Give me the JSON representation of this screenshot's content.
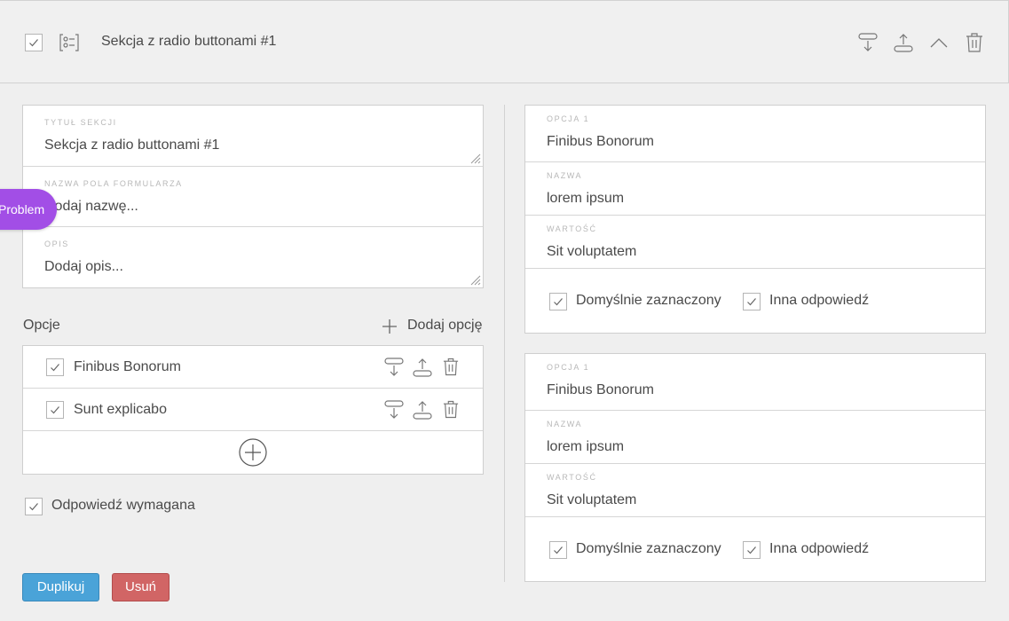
{
  "header": {
    "title": "Sekcja z radio buttonami #1",
    "checked": true
  },
  "section_fields": [
    {
      "label": "TYTUŁ SEKCJI",
      "value": "Sekcja z radio buttonami #1"
    },
    {
      "label": "NAZWA POLA FORMULARZA",
      "value": "Dodaj nazwę..."
    },
    {
      "label": "OPIS",
      "value": "Dodaj opis..."
    }
  ],
  "problem_tab": "Problem",
  "options": {
    "heading": "Opcje",
    "add_label": "Dodaj opcję",
    "items": [
      {
        "label": "Finibus Bonorum",
        "checked": true
      },
      {
        "label": "Sunt explicabo",
        "checked": true
      }
    ]
  },
  "required_label": "Odpowiedź wymagana",
  "buttons": {
    "duplicate": "Duplikuj",
    "delete": "Usuń"
  },
  "cards": [
    {
      "fields": [
        {
          "label": "OPCJA 1",
          "value": "Finibus Bonorum"
        },
        {
          "label": "NAZWA",
          "value": "lorem ipsum"
        },
        {
          "label": "WARTOŚĆ",
          "value": "Sit voluptatem"
        }
      ],
      "default_label": "Domyślnie zaznaczony",
      "other_label": "Inna odpowiedź"
    },
    {
      "fields": [
        {
          "label": "OPCJA 1",
          "value": "Finibus Bonorum"
        },
        {
          "label": "NAZWA",
          "value": "lorem ipsum"
        },
        {
          "label": "WARTOŚĆ",
          "value": "Sit voluptatem"
        }
      ],
      "default_label": "Domyślnie zaznaczony",
      "other_label": "Inna odpowiedź"
    }
  ],
  "colors": {
    "duplicate": "#4aa3d8",
    "delete": "#d16565",
    "problem": "#a24ee6"
  }
}
